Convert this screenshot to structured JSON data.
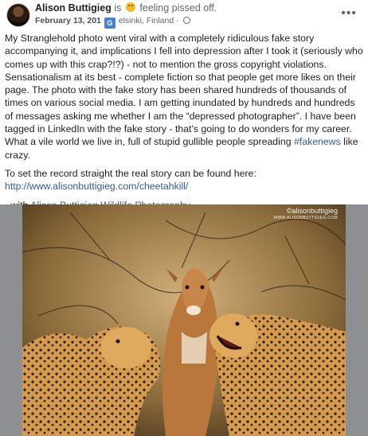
{
  "post": {
    "author": "Alison Buttigieg",
    "is_text": "is",
    "feeling": "feeling pissed off.",
    "date": "February 13, 201",
    "location": "elsinki, Finland",
    "translate_badge": "G",
    "more_icon": "more-horizontal-icon",
    "body": {
      "p1": "My Stranglehold photo went viral with a completely ridiculous fake story accompanying it, and implications I fell into depression after I took it (seriously who comes up with this crap?!?) - not to mention the gross copyright violations. Sensationalism at its best - complete fiction so that people get more likes on their page.  The photo with the fake story has been shared hundreds of thousands of times on various social media.  I am getting inundated by hundreds and hundreds of messages asking me whether I am the “depressed photographer”. I have been tagged in LinkedIn with the fake story - that's going to do wonders for my career. What a vile world we live in, full of stupid gullible people spreading ",
      "hashtag": "#fakenews",
      "p1_end": " like crazy.",
      "p2": "To set the record straight the real story can be found here:",
      "link": "http://www.alisonbuttigieg.com/cheetahkill/",
      "with_prefix": "- with ",
      "with_page": "Alison Buttigieg Wildlife Photography"
    }
  },
  "photo": {
    "watermark": "©alisonbuttigieg",
    "watermark_sub": "WWW.ALISONBUTTIGIEG.COM"
  }
}
